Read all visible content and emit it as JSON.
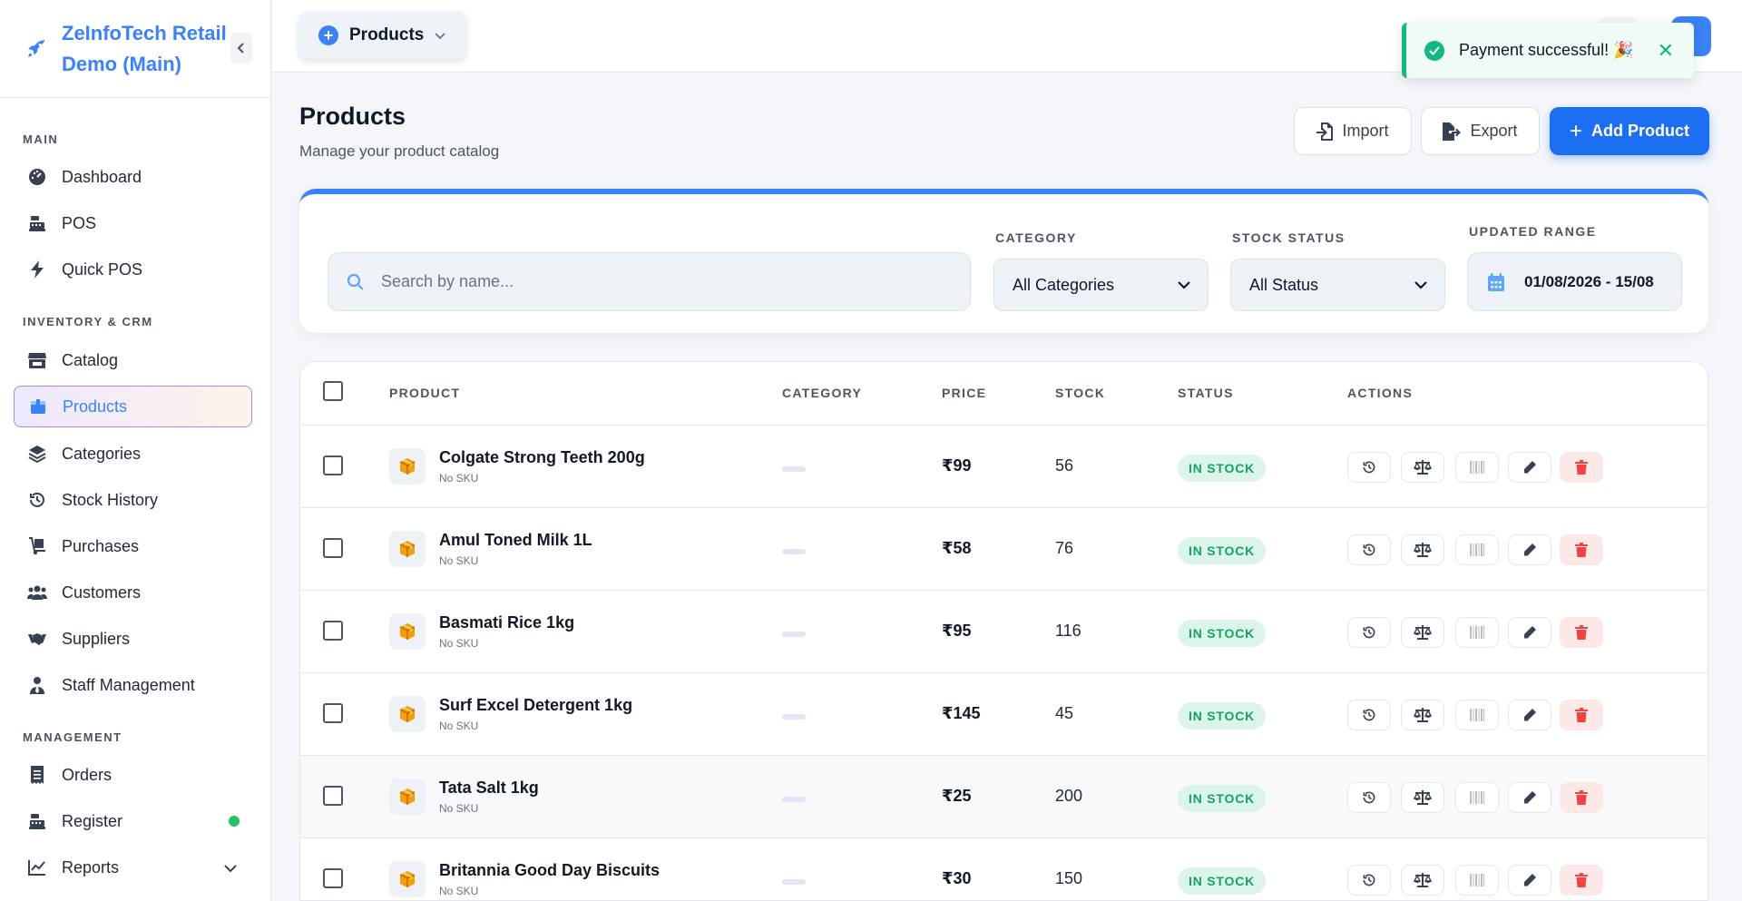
{
  "sidebar": {
    "brand": "ZeInfoTech Retail Demo (Main)",
    "sections": {
      "main": "MAIN",
      "inventory": "INVENTORY & CRM",
      "management": "MANAGEMENT"
    },
    "items": {
      "dashboard": "Dashboard",
      "pos": "POS",
      "quick_pos": "Quick POS",
      "catalog": "Catalog",
      "products": "Products",
      "categories": "Categories",
      "stock_history": "Stock History",
      "purchases": "Purchases",
      "customers": "Customers",
      "suppliers": "Suppliers",
      "staff": "Staff Management",
      "orders": "Orders",
      "register": "Register",
      "reports": "Reports"
    }
  },
  "topbar": {
    "breadcrumb": "Products"
  },
  "toast": {
    "message": "Payment successful! 🎉"
  },
  "header": {
    "title": "Products",
    "subtitle": "Manage your product catalog",
    "import_label": "Import",
    "export_label": "Export",
    "add_label": "Add Product"
  },
  "filters": {
    "search_placeholder": "Search by name...",
    "category_label": "CATEGORY",
    "category_value": "All Categories",
    "stock_label": "STOCK STATUS",
    "stock_value": "All Status",
    "range_label": "UPDATED RANGE",
    "range_value": "01/08/2026 - 15/08"
  },
  "table": {
    "columns": {
      "product": "PRODUCT",
      "category": "CATEGORY",
      "price": "PRICE",
      "stock": "STOCK",
      "status": "STATUS",
      "actions": "ACTIONS"
    },
    "rows": [
      {
        "name": "Colgate Strong Teeth 200g",
        "sku": "No SKU",
        "price": "₹99",
        "stock": "56",
        "status": "IN STOCK"
      },
      {
        "name": "Amul Toned Milk 1L",
        "sku": "No SKU",
        "price": "₹58",
        "stock": "76",
        "status": "IN STOCK"
      },
      {
        "name": "Basmati Rice 1kg",
        "sku": "No SKU",
        "price": "₹95",
        "stock": "116",
        "status": "IN STOCK"
      },
      {
        "name": "Surf Excel Detergent 1kg",
        "sku": "No SKU",
        "price": "₹145",
        "stock": "45",
        "status": "IN STOCK"
      },
      {
        "name": "Tata Salt 1kg",
        "sku": "No SKU",
        "price": "₹25",
        "stock": "200",
        "status": "IN STOCK"
      },
      {
        "name": "Britannia Good Day Biscuits",
        "sku": "No SKU",
        "price": "₹30",
        "stock": "150",
        "status": "IN STOCK"
      }
    ]
  },
  "colors": {
    "accent": "#3b82f6",
    "primary_button": "#1d6ff2",
    "success": "#10b981",
    "danger": "#ef4444"
  }
}
